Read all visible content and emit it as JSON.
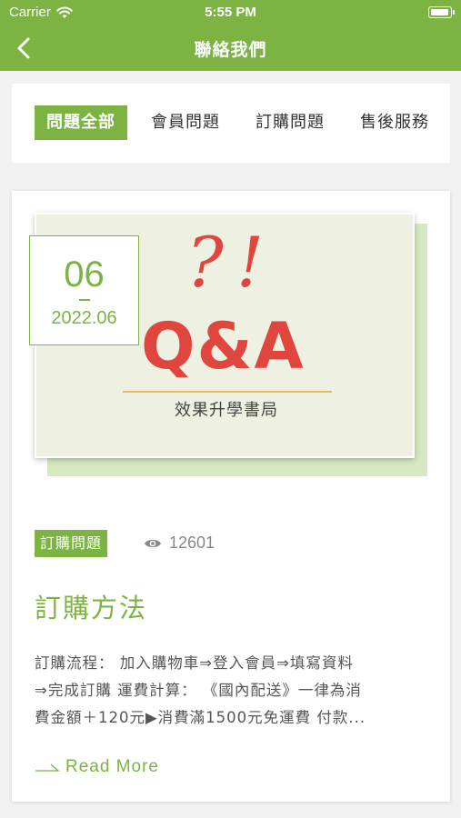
{
  "status_bar": {
    "carrier": "Carrier",
    "time": "5:55 PM",
    "wifi_icon": "wifi-icon",
    "battery_icon": "battery-icon"
  },
  "nav": {
    "title": "聯絡我們",
    "back_icon": "chevron-left-icon"
  },
  "tabs": [
    {
      "label": "問題全部",
      "active": true
    },
    {
      "label": "會員問題",
      "active": false
    },
    {
      "label": "訂購問題",
      "active": false
    },
    {
      "label": "售後服務",
      "active": false
    }
  ],
  "article": {
    "image": {
      "marks": "?!",
      "headline": "Q&A",
      "caption": "效果升學書局"
    },
    "date": {
      "day": "06",
      "year_month": "2022.06"
    },
    "category": "訂購問題",
    "views": "12601",
    "views_icon": "eye-icon",
    "title": "訂購方法",
    "excerpt_lines": [
      "訂購流程： 加入購物車⇒登入會員⇒填寫資料",
      "⇒完成訂購 運費計算： 《國內配送》一律為消",
      "費金額＋120元▶消費滿1500元免運費 付款..."
    ],
    "read_more": "Read More",
    "read_more_icon": "arrow-right-icon"
  },
  "colors": {
    "brand_green": "#7cb342",
    "qa_red": "#e0463d"
  }
}
